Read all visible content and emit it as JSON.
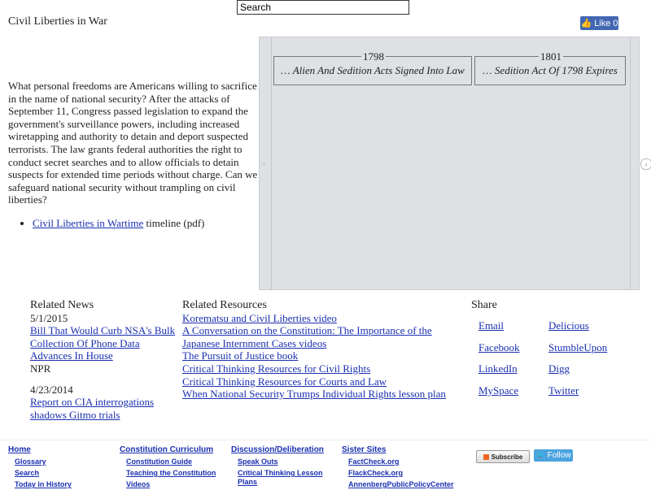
{
  "search": {
    "value": "Search"
  },
  "page": {
    "title": "Civil Liberties in War"
  },
  "like": {
    "label": "Like",
    "count": "0"
  },
  "intro": {
    "text": "What personal freedoms are Americans willing to sacrifice in the name of national security? After the attacks of September 11, Congress passed legislation to expand the government's surveillance powers, including increased wiretapping and authority to detain and deport suspected terrorists. The law grants federal authorities the right to conduct secret searches and to allow officials to detain suspects for extended time periods without charge. Can we safeguard national security without trampling on civil liberties?",
    "pdf_link": "Civil Liberties in Wartime",
    "pdf_suffix": " timeline (pdf)"
  },
  "timeline": {
    "events": [
      {
        "year": "1798",
        "text": "… Alien And Sedition Acts Signed Into Law"
      },
      {
        "year": "1801",
        "text": "… Sedition Act Of 1798 Expires"
      }
    ],
    "left_arrow": "‹",
    "right_arrow": "›"
  },
  "news": {
    "heading": "Related News",
    "items": [
      {
        "date": "5/1/2015",
        "title": "Bill That Would Curb NSA's Bulk Collection Of Phone Data Advances In House",
        "source": "NPR"
      },
      {
        "date": "4/23/2014",
        "title": "Report on CIA interrogations shadows Gitmo trials"
      }
    ]
  },
  "resources": {
    "heading": "Related Resources",
    "items": [
      "Korematsu and Civil Liberties video",
      "A Conversation on the Constitution: The Importance of the Japanese Internment Cases videos",
      "The Pursuit of Justice book",
      "Critical Thinking Resources for Civil Rights",
      "Critical Thinking Resources for Courts and Law",
      "When National Security Trumps Individual Rights lesson plan"
    ]
  },
  "share": {
    "heading": "Share",
    "links": [
      "Email",
      "Delicious",
      "Facebook",
      "StumbleUpon",
      "LinkedIn",
      "Digg",
      "MySpace",
      "Twitter"
    ]
  },
  "footer": {
    "col1": {
      "heading": "Home",
      "items": [
        "Glossary",
        "Search",
        "Today in History"
      ]
    },
    "col2": {
      "heading": "Constitution Curriculum",
      "items": [
        "Constitution Guide",
        "Teaching the Constitution",
        "Videos"
      ]
    },
    "col3": {
      "heading": "Discussion/Deliberation",
      "items": [
        "Speak Outs",
        "Critical Thinking Lesson Plans"
      ]
    },
    "col4": {
      "heading": "Sister Sites",
      "items": [
        "FactCheck.org",
        "FlackCheck.org",
        "AnnenbergPublicPolicyCenter"
      ]
    },
    "subscribe": "Subscribe",
    "follow": "Follow"
  }
}
